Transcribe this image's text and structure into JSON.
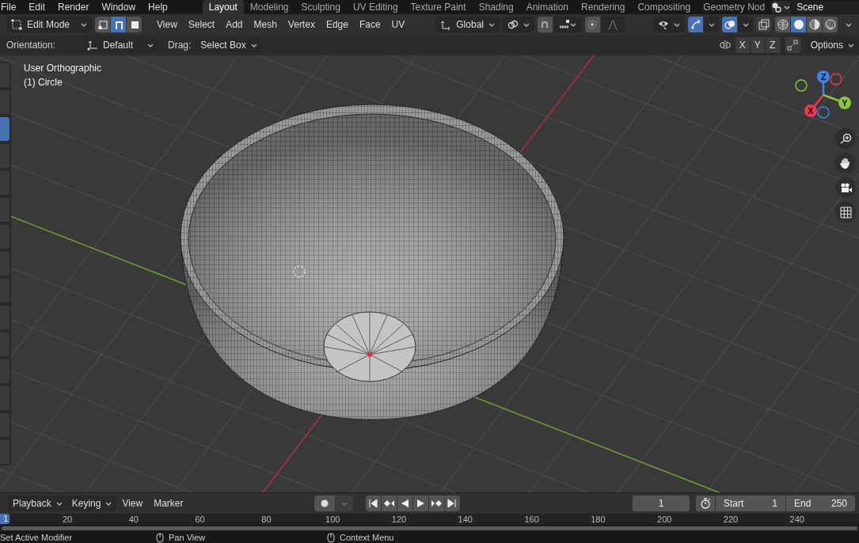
{
  "menu_bar": {
    "menus": [
      "File",
      "Edit",
      "Render",
      "Window",
      "Help"
    ],
    "workspaces": [
      {
        "label": "Layout",
        "selected": true
      },
      {
        "label": "Modeling",
        "selected": false
      },
      {
        "label": "Sculpting",
        "selected": false
      },
      {
        "label": "UV Editing",
        "selected": false
      },
      {
        "label": "Texture Paint",
        "selected": false
      },
      {
        "label": "Shading",
        "selected": false
      },
      {
        "label": "Animation",
        "selected": false
      },
      {
        "label": "Rendering",
        "selected": false
      },
      {
        "label": "Compositing",
        "selected": false
      },
      {
        "label": "Geometry Nod",
        "selected": false
      }
    ],
    "scene": "Scene"
  },
  "header": {
    "mode": "Edit Mode",
    "select_modes": [
      {
        "selected": false
      },
      {
        "selected": true
      },
      {
        "selected": false
      }
    ],
    "menus": [
      "View",
      "Select",
      "Add",
      "Mesh",
      "Vertex",
      "Edge",
      "Face",
      "UV"
    ],
    "orientation": "Global",
    "gizmos_on": true,
    "overlays_on": true,
    "xray_on": false,
    "shading_modes": [
      {
        "selected": false
      },
      {
        "selected": true
      },
      {
        "selected": false
      },
      {
        "selected": false
      }
    ]
  },
  "tool_settings": {
    "orientation_label": "Orientation:",
    "orientation": "Default",
    "drag_label": "Drag:",
    "drag": "Select Box",
    "axes": [
      "X",
      "Y",
      "Z"
    ],
    "options": "Options"
  },
  "toolbar": [
    {
      "selected": false
    },
    {
      "selected": false
    },
    {
      "selected": true
    },
    {
      "selected": false
    },
    {
      "selected": false
    },
    {
      "selected": false
    },
    {
      "selected": false
    },
    {
      "selected": false
    },
    {
      "selected": false
    },
    {
      "selected": false
    },
    {
      "selected": false
    },
    {
      "selected": false
    },
    {
      "selected": false
    },
    {
      "selected": false
    },
    {
      "selected": false
    }
  ],
  "viewport": {
    "view_name": "User Orthographic",
    "object_name": "(1) Circle",
    "gizmo_axes": [
      {
        "label": "X",
        "color": "#e8394f"
      },
      {
        "label": "Y",
        "color": "#8bc43d"
      },
      {
        "label": "Z",
        "color": "#3f84e8"
      }
    ]
  },
  "timeline": {
    "menus": [
      {
        "label": "Playback",
        "kind": "dropdown"
      },
      {
        "label": "Keying",
        "kind": "dropdown"
      },
      {
        "label": "View",
        "kind": "menu"
      },
      {
        "label": "Marker",
        "kind": "menu"
      }
    ],
    "current_frame": "1",
    "start_label": "Start",
    "start": "1",
    "end_label": "End",
    "end": "250",
    "playhead": "1",
    "ruler": [
      "20",
      "40",
      "60",
      "80",
      "100",
      "120",
      "140",
      "160",
      "180",
      "200",
      "220",
      "240"
    ]
  },
  "status_bar": [
    "Set Active Modifier",
    "Pan View",
    "Context Menu"
  ]
}
